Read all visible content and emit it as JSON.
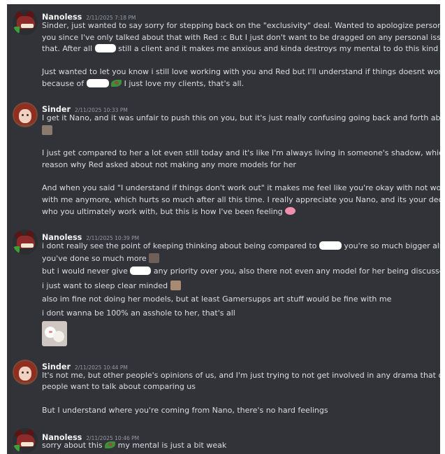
{
  "messages": [
    {
      "author": "Nanoless",
      "timestamp": "2/11/2025 7:18 PM",
      "lines": [
        {
          "a": "Sinder, just wanted to say sorry for stepping back on the \"exclusivity\" deal. Wanted to apologize personally to"
        },
        {
          "a": "you since I've only talked about that with Red :c But I just don't want to be dragged on any personal issues like"
        },
        {
          "a": "that. After all",
          "b": "still a client and it makes me anxious and kinda destroys my mental to do this kind of deal."
        },
        {
          "a": "Just wanted to let you know i still love working with you and Red but I'll understand if things doesnt work out"
        },
        {
          "a": "because of",
          "b": "I just love my clients, that's all."
        }
      ]
    },
    {
      "author": "Sinder",
      "timestamp": "2/11/2025 10:33 PM",
      "lines": [
        {
          "a": "I get it Nano, and it was unfair to push this on you, but it's just really confusing going back and forth about it"
        },
        {
          "a": "I just get compared to her a lot even still today and it's like I'm always living in someone's shadow, which is one"
        },
        {
          "a": "reason why Red asked about not making any more models for her"
        },
        {
          "a": "And when you said \"I understand if things don't work out\" it makes me feel like you're okay with not working"
        },
        {
          "a": "with me anymore, which hurts so much after all this time. I really appreciate you Nano, and its your decision"
        },
        {
          "a": "who you ultimately work with, but this is how I've been feeling"
        }
      ]
    },
    {
      "author": "Nanoless",
      "timestamp": "2/11/2025 10:39 PM",
      "lines": [
        {
          "a": "i dont really see the point of keeping thinking about being compared to",
          "b": "you're so much bigger already,"
        },
        {
          "a": "you've done so much more"
        },
        {
          "a": "but i would never give",
          "b": "any priority over you, also there not even any model for her being discussed"
        },
        {
          "a": "i just want to sleep clear minded"
        },
        {
          "a": "also im fine not doing her models, but at least Gamersupps art stuff would be fine with me"
        },
        {
          "a": "i dont wanna be 100% an asshole to her, that's all"
        }
      ]
    },
    {
      "author": "Sinder",
      "timestamp": "2/11/2025 10:44 PM",
      "lines": [
        {
          "a": "It's not me, but other people's opinions of us, and I'm just trying to not get involved in any drama that other"
        },
        {
          "a": "people want to talk about comparing us"
        },
        {
          "a": "But I understand where you're coming from Nano, there's no hard feelings"
        }
      ]
    },
    {
      "author": "Nanoless",
      "timestamp": "2/11/2025 10:46 PM",
      "lines": [
        {
          "a": "sorry about this",
          "b": "my mental is just a bit weak"
        }
      ]
    }
  ]
}
